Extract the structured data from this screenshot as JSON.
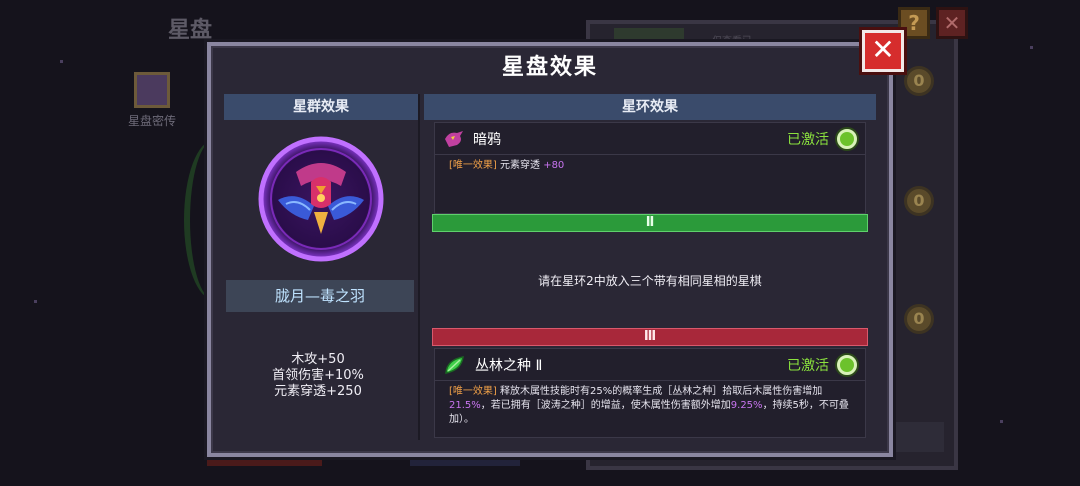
{
  "background": {
    "title": "星盘",
    "side_item_label": "星盘密传",
    "tab_label": "仅查看已",
    "coin_glyph": "0",
    "help_glyph": "?",
    "close_glyph": "✕"
  },
  "dialog": {
    "title": "星盘效果",
    "close_glyph": "✕"
  },
  "left": {
    "header": "星群效果",
    "emblem_icon": "crow-emblem-icon",
    "name": "胧月—毒之羽",
    "stats": [
      "木攻+50",
      "首领伤害+10%",
      "元素穿透+250"
    ]
  },
  "right": {
    "header": "星环效果",
    "effects": [
      {
        "name": "暗鸦",
        "icon": "crow-icon",
        "status": "已激活",
        "tag": "[唯一效果]",
        "desc_text": "元素穿透",
        "desc_value": "+80"
      },
      {
        "name": "丛林之种 Ⅱ",
        "icon": "leaf-seed-icon",
        "status": "已激活",
        "tag": "[唯一效果]",
        "desc_parts": [
          "释放木属性技能时有25%的概率生成［丛林之种］拾取后木属性伤害增加",
          "21.5%",
          "，若已拥有［波涛之种］的增益，使木属性伤害额外增加",
          "9.25%",
          "，持续5秒，不可叠加）。"
        ]
      }
    ],
    "ring_ii_label": "Ⅱ",
    "ring_ii_hint": "请在星环2中放入三个带有相同星相的星棋",
    "ring_iii_label": "Ⅲ"
  },
  "colors": {
    "active_green": "#8be23e",
    "tag_orange": "#f0a048",
    "highlight_purple": "#c874f0",
    "ring_ii": "#2b9a3a",
    "ring_iii": "#a8283a"
  }
}
